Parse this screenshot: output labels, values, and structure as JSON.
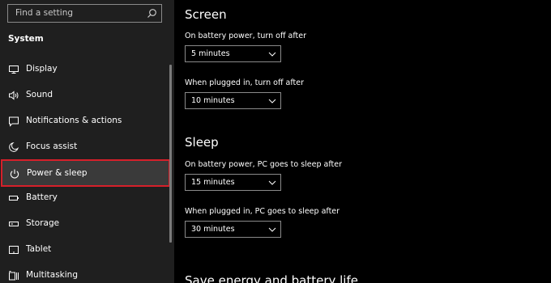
{
  "search": {
    "placeholder": "Find a setting"
  },
  "sidebar": {
    "category": "System",
    "items": [
      {
        "label": "Display",
        "icon": "monitor-icon"
      },
      {
        "label": "Sound",
        "icon": "speaker-icon"
      },
      {
        "label": "Notifications & actions",
        "icon": "notification-icon"
      },
      {
        "label": "Focus assist",
        "icon": "moon-icon"
      },
      {
        "label": "Power & sleep",
        "icon": "power-icon",
        "selected": true
      },
      {
        "label": "Battery",
        "icon": "battery-icon"
      },
      {
        "label": "Storage",
        "icon": "storage-icon"
      },
      {
        "label": "Tablet",
        "icon": "tablet-icon"
      },
      {
        "label": "Multitasking",
        "icon": "multitasking-icon"
      }
    ]
  },
  "screen": {
    "title": "Screen",
    "battery_label": "On battery power, turn off after",
    "battery_value": "5 minutes",
    "plugged_label": "When plugged in, turn off after",
    "plugged_value": "10 minutes"
  },
  "sleep": {
    "title": "Sleep",
    "battery_label": "On battery power, PC goes to sleep after",
    "battery_value": "15 minutes",
    "plugged_label": "When plugged in, PC goes to sleep after",
    "plugged_value": "30 minutes"
  },
  "save_energy": {
    "title": "Save energy and battery life"
  },
  "colors": {
    "sidebar_bg": "#1f1f1f",
    "main_bg": "#000000",
    "selected_bg": "#3a3a3a",
    "selected_border": "#d6202a",
    "text": "#ffffff"
  }
}
